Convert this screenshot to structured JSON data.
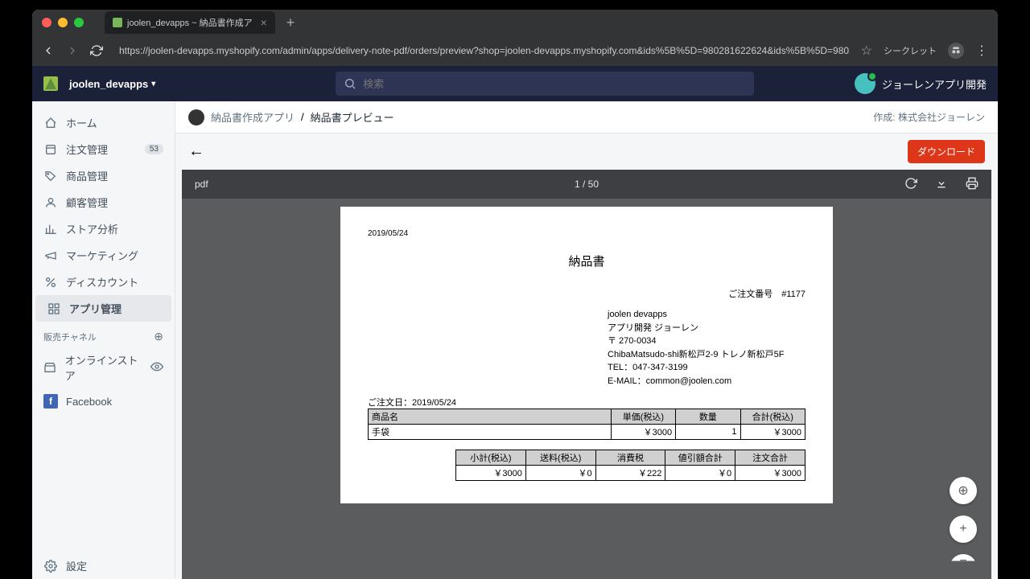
{
  "browser": {
    "tab_title": "joolen_devapps ~ 納品書作成ア",
    "url": "https://joolen-devapps.myshopify.com/admin/apps/delivery-note-pdf/orders/preview?shop=joolen-devapps.myshopify.com&ids%5B%5D=980281622624&ids%5B%5D=980279459936&i...",
    "incognito": "シークレット"
  },
  "topbar": {
    "store": "joolen_devapps",
    "search_placeholder": "検索",
    "username": "ジョーレンアプリ開発"
  },
  "sidebar": {
    "items": [
      {
        "label": "ホーム",
        "badge": null
      },
      {
        "label": "注文管理",
        "badge": "53"
      },
      {
        "label": "商品管理",
        "badge": null
      },
      {
        "label": "顧客管理",
        "badge": null
      },
      {
        "label": "ストア分析",
        "badge": null
      },
      {
        "label": "マーケティング",
        "badge": null
      },
      {
        "label": "ディスカウント",
        "badge": null
      },
      {
        "label": "アプリ管理",
        "badge": null
      }
    ],
    "channels_header": "販売チャネル",
    "channels": [
      {
        "label": "オンラインストア"
      },
      {
        "label": "Facebook"
      }
    ],
    "settings": "設定"
  },
  "apphdr": {
    "app": "納品書作成アプリ",
    "page": "納品書プレビュー",
    "maker_label": "作成:",
    "maker": "株式会社ジョーレン"
  },
  "toolbar": {
    "download": "ダウンロード"
  },
  "pdfbar": {
    "name": "pdf",
    "page": "1 / 50"
  },
  "doc": {
    "date": "2019/05/24",
    "title": "納品書",
    "orderno_label": "ご注文番号",
    "orderno": "#1177",
    "seller": {
      "name": "joolen devapps",
      "dept": "アプリ開発 ジョーレン",
      "zip": "〒 270-0034",
      "addr": "ChibaMatsudo-shi新松戸2-9 トレノ新松戸5F",
      "tel": "TEL：047-347-3199",
      "email": "E-MAIL：common@joolen.com"
    },
    "orderdate_label": "ご注文日：",
    "orderdate": "2019/05/24",
    "t1_headers": [
      "商品名",
      "単価(税込)",
      "数量",
      "合計(税込)"
    ],
    "t1_rows": [
      [
        "手袋",
        "￥3000",
        "1",
        "￥3000"
      ]
    ],
    "t2_headers": [
      "小計(税込)",
      "送料(税込)",
      "消費税",
      "値引額合計",
      "注文合計"
    ],
    "t2_row": [
      "￥3000",
      "￥0",
      "￥222",
      "￥0",
      "￥3000"
    ]
  }
}
